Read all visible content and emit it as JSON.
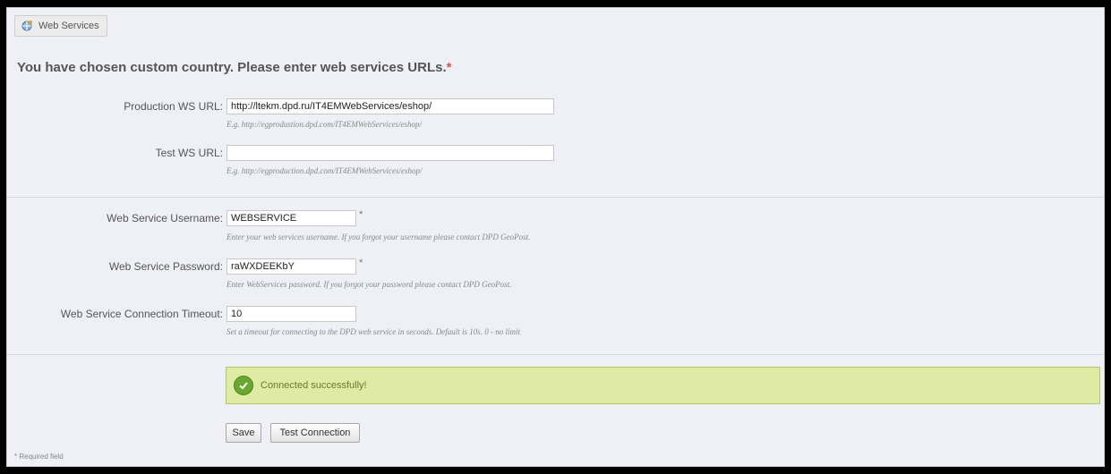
{
  "panel": {
    "legend_title": "Web Services",
    "legend_icon": "web-services-icon"
  },
  "heading": {
    "text": "You have chosen custom country. Please enter web services URLs.",
    "required_mark": "*"
  },
  "fields": {
    "production_ws_url": {
      "label": "Production WS URL:",
      "value": "http://ltekm.dpd.ru/IT4EMWebServices/eshop/",
      "help": "E.g. http://egprodustion.dpd.com/IT4EMWebServices/eshop/"
    },
    "test_ws_url": {
      "label": "Test WS URL:",
      "value": "",
      "help": "E.g. http://egproduction.dpd.com/IT4EMWebServices/eshop/"
    },
    "username": {
      "label": "Web Service Username:",
      "value": "WEBSERVICE",
      "required_mark": "*",
      "help": "Enter your web services username. If you forgot your username please contact DPD GeoPost."
    },
    "password": {
      "label": "Web Service Password:",
      "value": "raWXDEEKbY",
      "required_mark": "*",
      "help": "Enter WebServices password. If you forgot your password please contact DPD GeoPost."
    },
    "timeout": {
      "label": "Web Service Connection Timeout:",
      "value": "10",
      "help": "Set a timeout for connecting to the DPD web service in seconds. Default is 10s. 0 - no limit"
    }
  },
  "status": {
    "message": "Connected successfully!",
    "icon": "check-circle-icon",
    "color": "#dfeaa5"
  },
  "buttons": {
    "save": "Save",
    "test_connection": "Test Connection"
  },
  "footnote": "* Required field"
}
